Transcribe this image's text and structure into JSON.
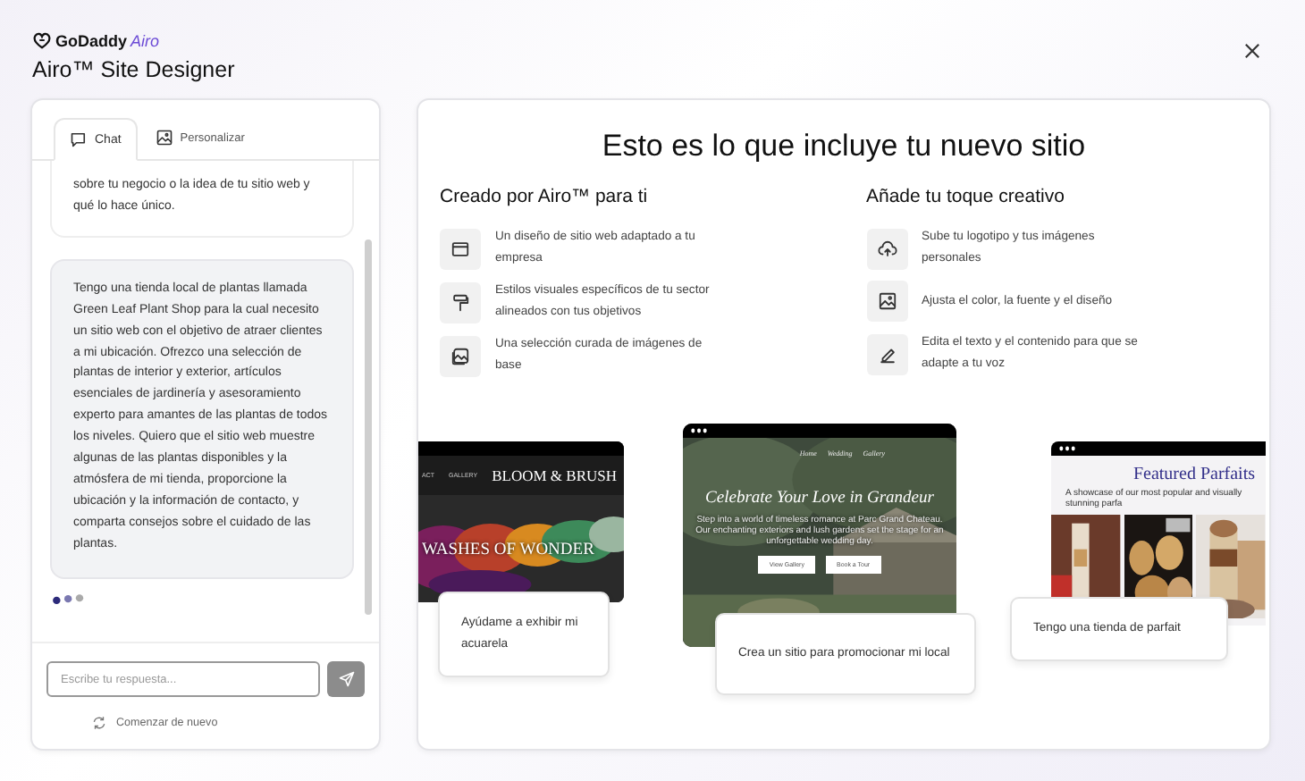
{
  "header": {
    "logo": "GoDaddy",
    "logo_product": "Airo",
    "title": "Airo™ Site Designer"
  },
  "chat_panel": {
    "tabs": [
      {
        "label": "Chat",
        "selected": true
      },
      {
        "label": "Personalizar",
        "selected": false
      }
    ],
    "messages": [
      {
        "text": "sobre tu negocio o la idea de tu sitio web y qué lo hace único."
      },
      {
        "text": "Tengo una tienda local de plantas llamada Green Leaf Plant Shop para la cual necesito un sitio web con el objetivo de atraer clientes a mi ubicación. Ofrezco una selección de plantas de interior y exterior, artículos esenciales de jardinería y asesoramiento experto para amantes de las plantas de todos los niveles. Quiero que el sitio web muestre algunas de las plantas disponibles y la atmósfera de mi tienda, proporcione la ubicación y la información de contacto, y comparta consejos sobre el cuidado de las plantas."
      }
    ],
    "input": {
      "placeholder": "Escribe tu respuesta..."
    },
    "restart": "Comenzar de nuevo"
  },
  "includes": {
    "title": "Esto es lo que incluye tu nuevo sitio",
    "columns": [
      {
        "heading": "Creado por Airo™ para ti",
        "items": [
          {
            "text": "Un diseño de sitio web adaptado a tu empresa"
          },
          {
            "text": "Estilos visuales específicos de tu sector alineados con tus objetivos"
          },
          {
            "text": "Una selección curada de imágenes de base"
          }
        ]
      },
      {
        "heading": "Añade tu toque creativo",
        "items": [
          {
            "text": "Sube tu logotipo y tus imágenes personales"
          },
          {
            "text": "Ajusta el color, la fuente y el diseño"
          },
          {
            "text": "Edita el texto y el contenido para que se adapte a tu voz"
          }
        ]
      }
    ]
  },
  "examples": [
    {
      "kind": "art",
      "nav": [
        "ACT",
        "GALLERY"
      ],
      "brand": "BLOOM & BRUSH",
      "headline": "WASHES OF WONDER",
      "prompt": "Ayúdame a exhibir mi acuarela"
    },
    {
      "kind": "venue",
      "nav": [
        "Home",
        "Wedding",
        "Gallery"
      ],
      "headline": "Celebrate Your Love in Grandeur",
      "body": "Step into a world of timeless romance at Parc Grand Chateau. Our enchanting exteriors and lush gardens set the stage for an unforgettable wedding day.",
      "buttons": [
        "View Gallery",
        "Book a Tour"
      ],
      "prompt": "Crea un sitio para promocionar mi local"
    },
    {
      "kind": "shop",
      "headline": "Featured Parfaits",
      "subtitle": "A showcase of our most popular and visually stunning parfa",
      "prompt": "Tengo una tienda de parfait"
    }
  ]
}
